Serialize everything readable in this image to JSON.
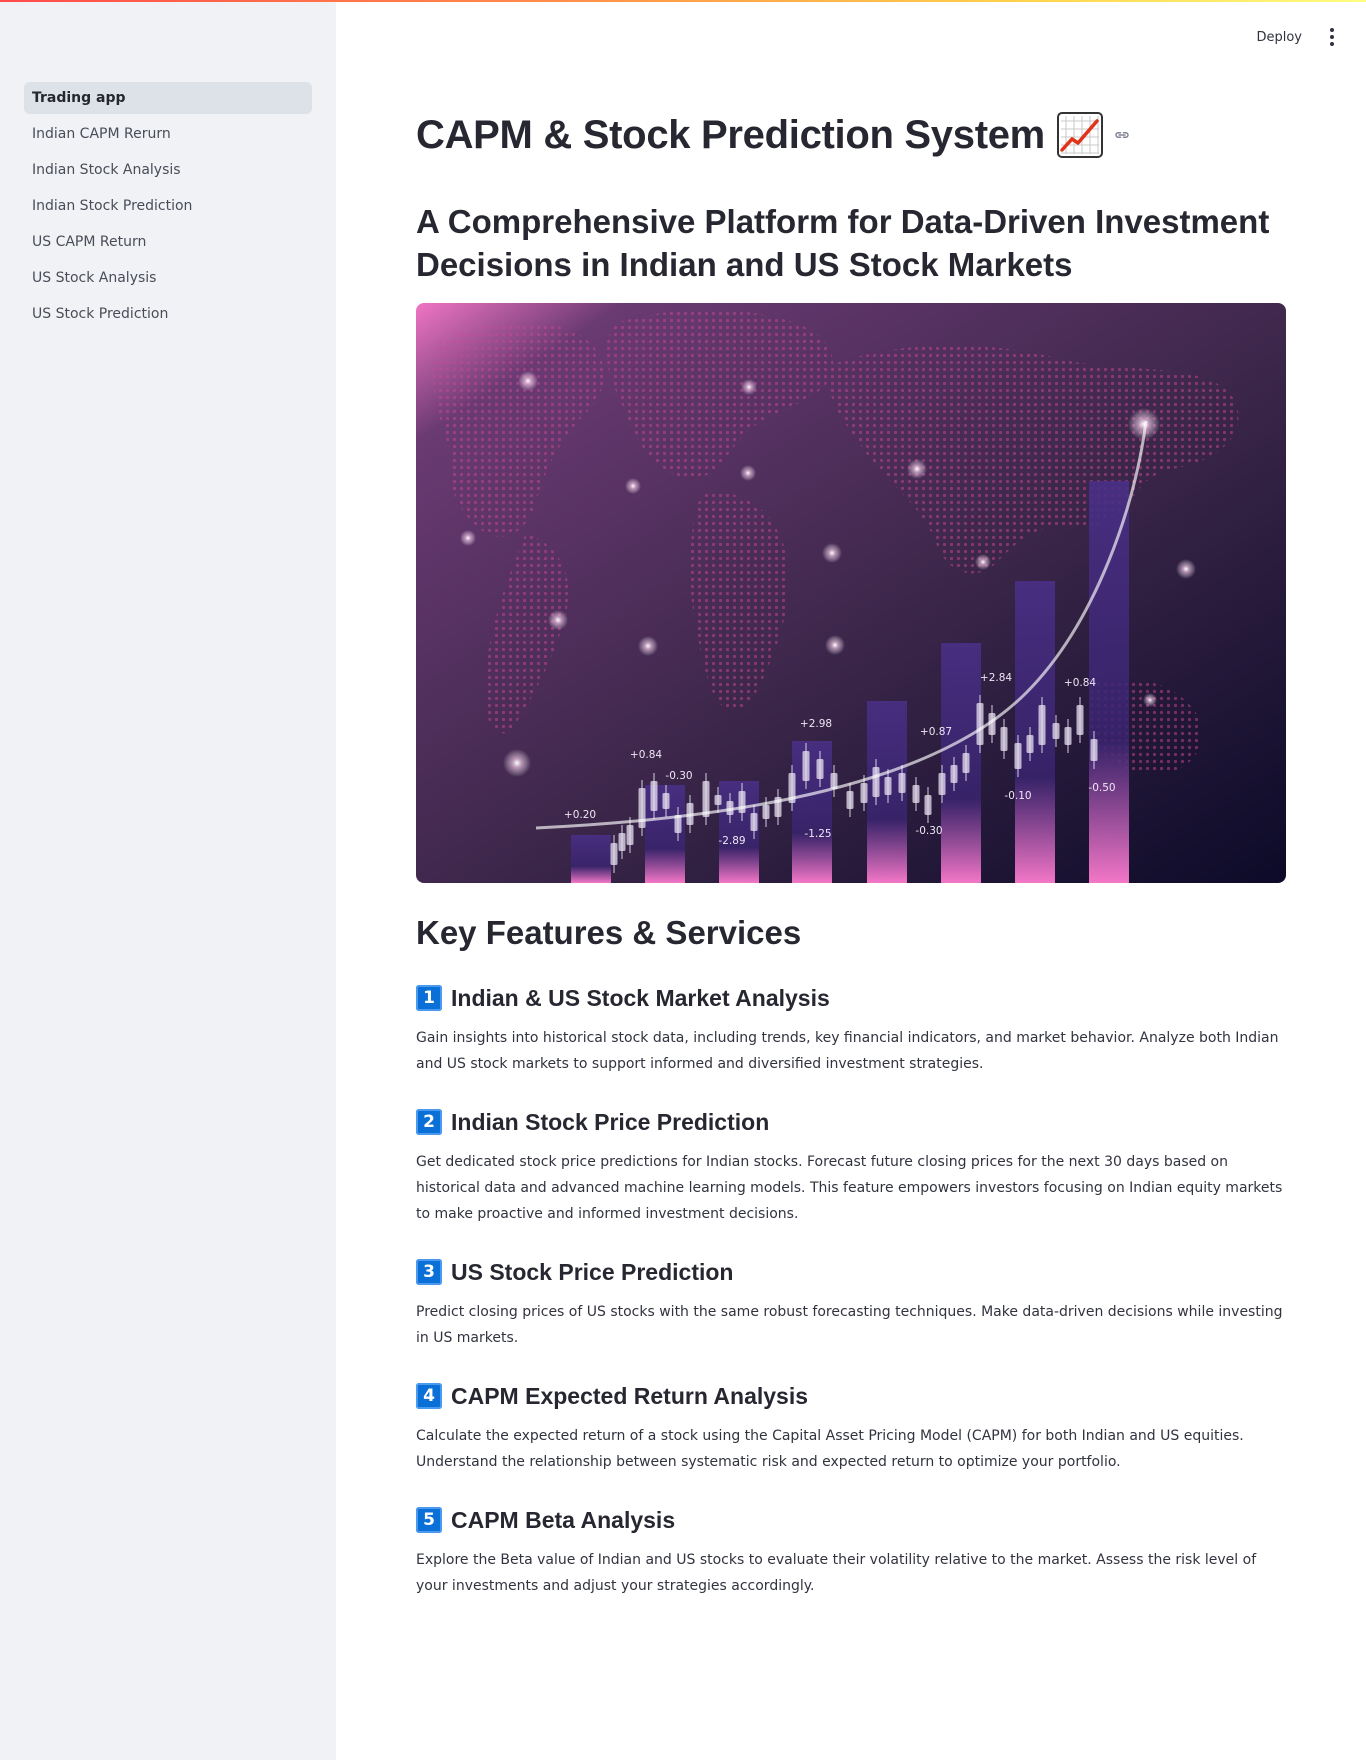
{
  "sidebar": {
    "items": [
      {
        "label": "Trading app",
        "active": true
      },
      {
        "label": "Indian CAPM Rerurn",
        "active": false
      },
      {
        "label": "Indian Stock Analysis",
        "active": false
      },
      {
        "label": "Indian Stock Prediction",
        "active": false
      },
      {
        "label": "US CAPM Return",
        "active": false
      },
      {
        "label": "US Stock Analysis",
        "active": false
      },
      {
        "label": "US Stock Prediction",
        "active": false
      }
    ]
  },
  "header": {
    "deploy_label": "Deploy",
    "menu_icon": "kebab-menu-icon"
  },
  "main": {
    "title": "CAPM & Stock Prediction System",
    "title_emoji": "chart-increasing-icon",
    "anchor_icon": "link-icon",
    "subtitle": "A Comprehensive Platform for Data-Driven Investment Decisions in Indian and US Stock Markets",
    "hero_image": {
      "labels": [
        "+0.20",
        "+0.84",
        "-0.30",
        "-2.89",
        "+2.98",
        "-1.25",
        "+0.87",
        "-0.30",
        "+2.84",
        "-0.10",
        "+0.84",
        "-0.50"
      ]
    },
    "features_title": "Key Features & Services",
    "features": [
      {
        "number": "1",
        "title": "Indian & US Stock Market Analysis",
        "description": "Gain insights into historical stock data, including trends, key financial indicators, and market behavior. Analyze both Indian and US stock markets to support informed and diversified investment strategies."
      },
      {
        "number": "2",
        "title": "Indian Stock Price Prediction",
        "description": "Get dedicated stock price predictions for Indian stocks. Forecast future closing prices for the next 30 days based on historical data and advanced machine learning models. This feature empowers investors focusing on Indian equity markets to make proactive and informed investment decisions."
      },
      {
        "number": "3",
        "title": "US Stock Price Prediction",
        "description": "Predict closing prices of US stocks with the same robust forecasting techniques. Make data-driven decisions while investing in US markets."
      },
      {
        "number": "4",
        "title": "CAPM Expected Return Analysis",
        "description": "Calculate the expected return of a stock using the Capital Asset Pricing Model (CAPM) for both Indian and US equities. Understand the relationship between systematic risk and expected return to optimize your portfolio."
      },
      {
        "number": "5",
        "title": "CAPM Beta Analysis",
        "description": "Explore the Beta value of Indian and US stocks to evaluate their volatility relative to the market. Assess the risk level of your investments and adjust your strategies accordingly."
      }
    ]
  },
  "colors": {
    "sidebar_bg": "#f0f2f6",
    "active_item_bg": "#dde1e8",
    "badge_blue": "#0a6fd6",
    "text": "#31333F"
  }
}
